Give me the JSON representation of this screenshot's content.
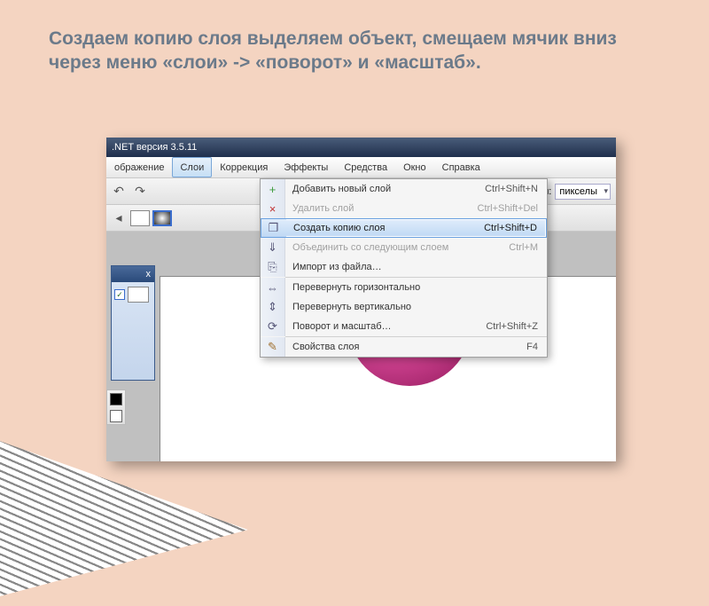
{
  "slide": {
    "title": "Создаем копию слоя выделяем объект, смещаем мячик вниз через меню «слои» -> «поворот» и «масштаб»."
  },
  "titlebar": {
    "text": ".NET версия 3.5.11"
  },
  "menubar": {
    "items": [
      {
        "label": "ображение"
      },
      {
        "label": "Слои",
        "open": true
      },
      {
        "label": "Коррекция"
      },
      {
        "label": "Эффекты"
      },
      {
        "label": "Средства"
      },
      {
        "label": "Окно"
      },
      {
        "label": "Справка"
      }
    ]
  },
  "toolbar": {
    "units_label": "ерения:",
    "units_value": "пикселы"
  },
  "dropdown": {
    "items": [
      {
        "type": "item",
        "icon": "add-layer-icon",
        "iconGlyph": "+",
        "iconColor": "#3a9a3a",
        "label": "Добавить новый слой",
        "shortcut": "Ctrl+Shift+N",
        "state": "normal"
      },
      {
        "type": "item",
        "icon": "delete-layer-icon",
        "iconGlyph": "×",
        "iconColor": "#c03030",
        "label": "Удалить слой",
        "shortcut": "Ctrl+Shift+Del",
        "state": "disabled"
      },
      {
        "type": "item",
        "icon": "copy-layer-icon",
        "iconGlyph": "❐",
        "iconColor": "#557",
        "label": "Создать копию слоя",
        "shortcut": "Ctrl+Shift+D",
        "state": "highlight"
      },
      {
        "type": "item",
        "icon": "merge-down-icon",
        "iconGlyph": "⇓",
        "iconColor": "#557",
        "label": "Объединить со следующим слоем",
        "shortcut": "Ctrl+M",
        "state": "disabled"
      },
      {
        "type": "item",
        "icon": "import-icon",
        "iconGlyph": "⎘",
        "iconColor": "#557",
        "label": "Импорт из файла…",
        "shortcut": "",
        "state": "normal"
      },
      {
        "type": "sep"
      },
      {
        "type": "item",
        "icon": "flip-horizontal-icon",
        "iconGlyph": "⇔",
        "iconColor": "#557",
        "label": "Перевернуть горизонтально",
        "shortcut": "",
        "state": "normal"
      },
      {
        "type": "item",
        "icon": "flip-vertical-icon",
        "iconGlyph": "⇕",
        "iconColor": "#557",
        "label": "Перевернуть вертикально",
        "shortcut": "",
        "state": "normal"
      },
      {
        "type": "item",
        "icon": "rotate-zoom-icon",
        "iconGlyph": "⟳",
        "iconColor": "#557",
        "label": "Поворот и масштаб…",
        "shortcut": "Ctrl+Shift+Z",
        "state": "normal"
      },
      {
        "type": "sep"
      },
      {
        "type": "item",
        "icon": "layer-props-icon",
        "iconGlyph": "✎",
        "iconColor": "#a07030",
        "label": "Свойства слоя",
        "shortcut": "F4",
        "state": "normal"
      }
    ]
  },
  "layers_panel": {
    "close": "x"
  },
  "colors": {
    "ball": "#c94590",
    "background": "#f4d4c1"
  }
}
